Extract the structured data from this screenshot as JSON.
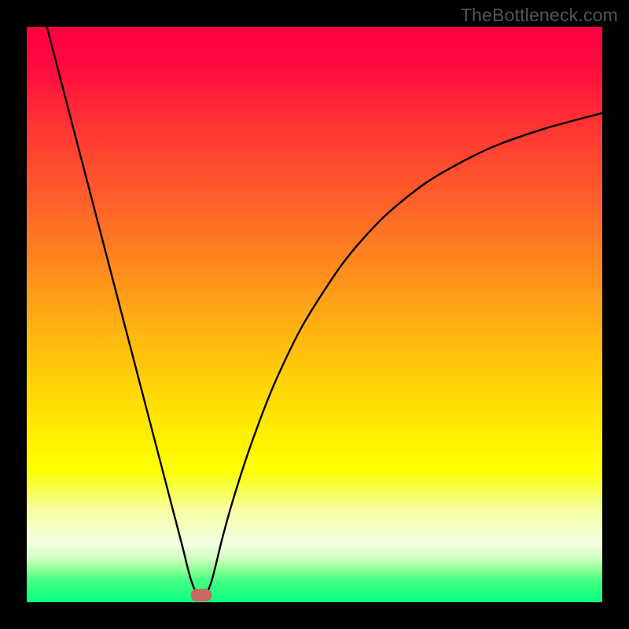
{
  "watermark": "TheBottleneck.com",
  "chart_data": {
    "type": "line",
    "title": "",
    "xlabel": "",
    "ylabel": "",
    "xlim": [
      0,
      100
    ],
    "ylim": [
      0,
      100
    ],
    "marker": {
      "x": 30.3,
      "y": 1.2,
      "color": "#cc6662"
    },
    "gradient_stops": [
      {
        "pos": 0,
        "color": "#ff0042"
      },
      {
        "pos": 50,
        "color": "#ffb412"
      },
      {
        "pos": 77,
        "color": "#fcff01"
      },
      {
        "pos": 100,
        "color": "#06ff82"
      }
    ],
    "series": [
      {
        "name": "curve",
        "x": [
          3.5,
          6,
          9,
          12,
          15,
          18,
          21,
          24,
          27,
          28.6,
          30.3,
          32,
          34,
          36,
          39,
          43,
          48,
          55,
          62,
          70,
          80,
          90,
          100
        ],
        "y": [
          100,
          90.4,
          78.9,
          67.4,
          55.9,
          44.4,
          32.9,
          21.4,
          9.9,
          3.7,
          0.5,
          3.3,
          11.2,
          18.3,
          27.5,
          37.9,
          48.2,
          59.0,
          66.9,
          73.3,
          78.7,
          82.3,
          85.0
        ]
      }
    ]
  }
}
